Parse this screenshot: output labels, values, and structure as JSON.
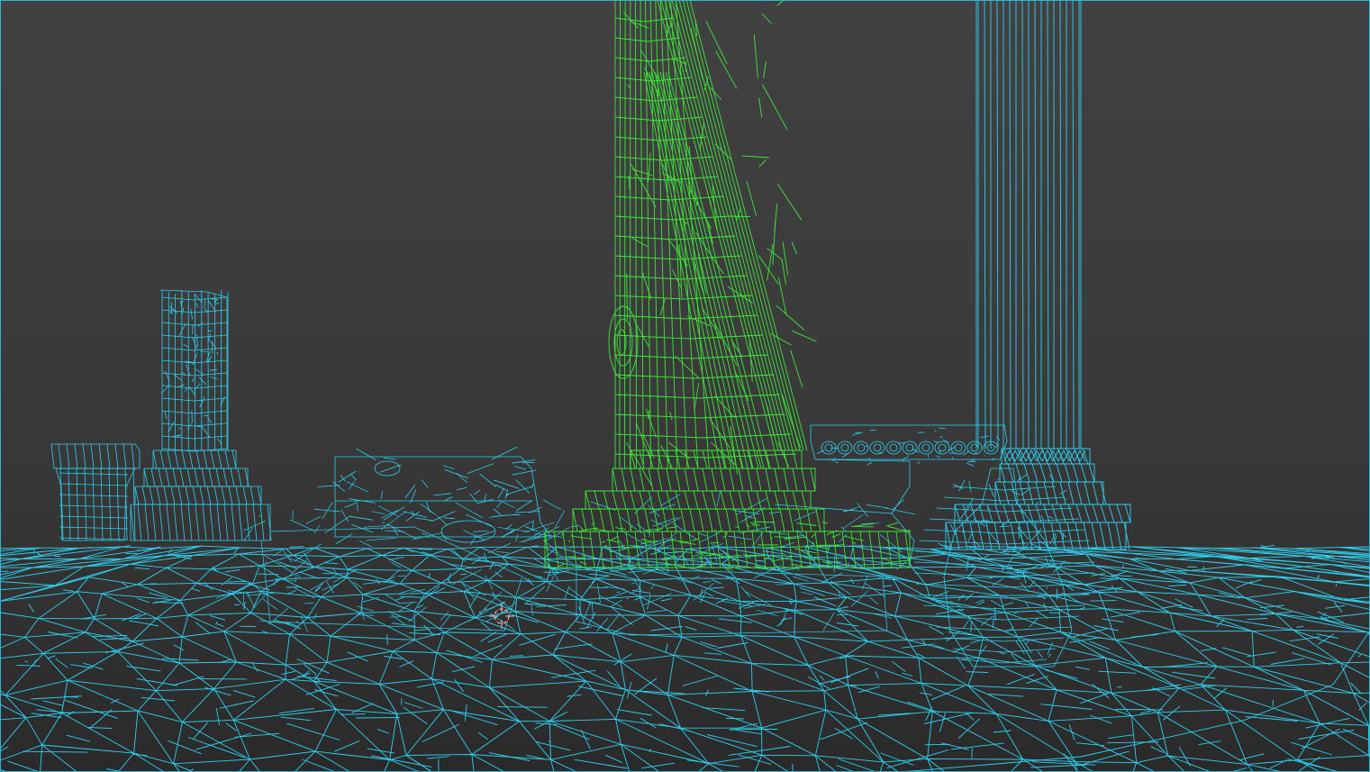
{
  "viewport": {
    "mode": "wireframe",
    "background_top": "#3f3f3f",
    "background_bottom": "#2c2c2c",
    "colors": {
      "unselected_wire": "#2fd0f0",
      "selected_wire": "#3ee63a",
      "border": "#2fb5d6"
    },
    "selected_object": "leaning-column",
    "icons": [
      "3d-cursor-icon"
    ]
  }
}
